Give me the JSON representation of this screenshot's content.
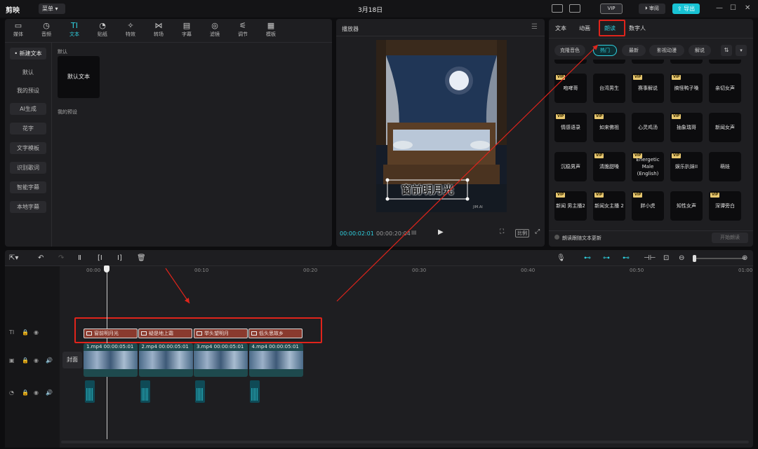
{
  "app": {
    "logo": "剪映",
    "menu_label": "菜单",
    "project_title": "3月18日"
  },
  "titlebar": {
    "vip_label": "VIP",
    "review_label": "审阅",
    "export_label": "导出"
  },
  "left_panel": {
    "tabs": [
      {
        "label": "媒体",
        "icon": "media-icon"
      },
      {
        "label": "音频",
        "icon": "audio-icon"
      },
      {
        "label": "文本",
        "icon": "text-icon",
        "active": true
      },
      {
        "label": "贴纸",
        "icon": "sticker-icon"
      },
      {
        "label": "特效",
        "icon": "effects-icon"
      },
      {
        "label": "转场",
        "icon": "transition-icon"
      },
      {
        "label": "字幕",
        "icon": "caption-icon"
      },
      {
        "label": "滤镜",
        "icon": "filter-icon"
      },
      {
        "label": "调节",
        "icon": "adjust-icon"
      },
      {
        "label": "模板",
        "icon": "template-icon"
      }
    ],
    "sidebar": [
      {
        "label": "• 新建文本",
        "selected": true
      },
      {
        "label": "默认"
      },
      {
        "label": "我的预设"
      },
      {
        "label": "AI生成"
      },
      {
        "label": "花字"
      },
      {
        "label": "文字模板"
      },
      {
        "label": "识别歌词"
      },
      {
        "label": "智能字幕"
      },
      {
        "label": "本地字幕"
      }
    ],
    "default_section_label": "默认",
    "default_card_label": "默认文本",
    "my_preset_section_label": "我的预设"
  },
  "player": {
    "title": "播放器",
    "overlay_text": "窗前明月光",
    "watermark": "JIM.AI",
    "time_current": "00:00:02:01",
    "time_total": "00:00:20:04",
    "ratio_label": "比例"
  },
  "right_panel": {
    "tabs": [
      {
        "label": "文本"
      },
      {
        "label": "动画"
      },
      {
        "label": "朗读",
        "active": true
      },
      {
        "label": "数字人"
      }
    ],
    "filters": [
      {
        "label": "克隆音色"
      },
      {
        "label": "热门",
        "active": true
      },
      {
        "label": "最新"
      },
      {
        "label": "影视动漫"
      },
      {
        "label": "解说"
      }
    ],
    "voices": [
      {
        "label": "咆哮哥",
        "vip": true
      },
      {
        "label": "台湾男生",
        "vip": false
      },
      {
        "label": "赛事解说",
        "vip": true
      },
      {
        "label": "搞怪鸭子嗓",
        "vip": true
      },
      {
        "label": "亲切女声",
        "vip": false
      },
      {
        "label": "情感语录",
        "vip": true
      },
      {
        "label": "如来佛祖",
        "vip": true
      },
      {
        "label": "心灵鸡汤",
        "vip": false
      },
      {
        "label": "抽象瑞哥",
        "vip": true
      },
      {
        "label": "新闻女声",
        "vip": false
      },
      {
        "label": "沉稳男声",
        "vip": false
      },
      {
        "label": "清脆甜嗓",
        "vip": true
      },
      {
        "label": "Energetic Male (English)",
        "vip": true
      },
      {
        "label": "娱乐扒妹II",
        "vip": true
      },
      {
        "label": "萌娃",
        "vip": false
      },
      {
        "label": "新闻 男主播2",
        "vip": true
      },
      {
        "label": "新闻女主播 2",
        "vip": true
      },
      {
        "label": "胖小虎",
        "vip": true
      },
      {
        "label": "知性女声",
        "vip": false
      },
      {
        "label": "深谭旁白",
        "vip": true
      }
    ],
    "vip_tag": "VIP",
    "follow_text_label": "朗读跟随文本更新",
    "start_reading_label": "开始朗读"
  },
  "timeline": {
    "ruler_labels": [
      "00:00",
      "00:10",
      "00:20",
      "00:30",
      "00:40",
      "00:50",
      "01:00"
    ],
    "text_clips": [
      "窗前明月光",
      "疑是地上霜",
      "举头望明月",
      "低头思故乡"
    ],
    "cover_label": "封面",
    "video_clips": [
      {
        "name": "1.mp4",
        "duration": "00:00:05:01"
      },
      {
        "name": "2.mp4",
        "duration": "00:00:05:01"
      },
      {
        "name": "3.mp4",
        "duration": "00:00:05:01"
      },
      {
        "name": "4.mp4",
        "duration": "00:00:05:01"
      }
    ]
  },
  "colors": {
    "accent": "#2fd0e0",
    "highlight_red": "#e0241b",
    "text_clip": "#8a3a2e",
    "video_clip": "#1e4a4e"
  }
}
